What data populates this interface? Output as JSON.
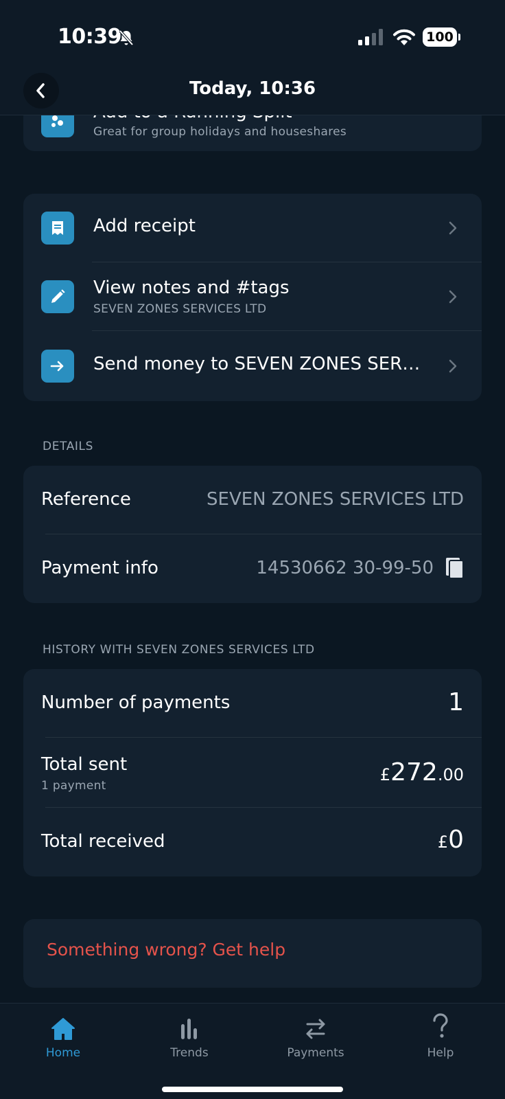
{
  "status": {
    "time": "10:39",
    "battery": "100"
  },
  "header": {
    "title": "Today, 10:36"
  },
  "running_split": {
    "title": "Add to a Running Split",
    "subtitle": "Great for group holidays and houseshares"
  },
  "actions": [
    {
      "title": "Add receipt",
      "subtitle": ""
    },
    {
      "title": "View notes and #tags",
      "subtitle": "SEVEN ZONES SERVICES LTD"
    },
    {
      "title": "Send money to SEVEN ZONES SER…",
      "subtitle": ""
    }
  ],
  "details": {
    "section_label": "DETAILS",
    "reference_label": "Reference",
    "reference_value": "SEVEN ZONES SERVICES LTD",
    "payment_info_label": "Payment info",
    "payment_info_value": "14530662 30-99-50"
  },
  "history": {
    "section_label": "HISTORY WITH SEVEN ZONES SERVICES LTD",
    "num_payments_label": "Number of payments",
    "num_payments_value": "1",
    "total_sent_label": "Total sent",
    "total_sent_sub": "1 payment",
    "total_sent_currency": "£",
    "total_sent_major": "272",
    "total_sent_minor": ".00",
    "total_received_label": "Total received",
    "total_received_currency": "£",
    "total_received_major": "0"
  },
  "help": {
    "label": "Something wrong? Get help"
  },
  "tabs": [
    {
      "label": "Home",
      "icon": "home-icon",
      "active": true
    },
    {
      "label": "Trends",
      "icon": "trends-icon",
      "active": false
    },
    {
      "label": "Payments",
      "icon": "payments-icon",
      "active": false
    },
    {
      "label": "Help",
      "icon": "help-icon",
      "active": false
    }
  ],
  "colors": {
    "accent": "#2f9ad6",
    "danger": "#e5534b",
    "card": "#13212f",
    "background": "#0b1722"
  }
}
